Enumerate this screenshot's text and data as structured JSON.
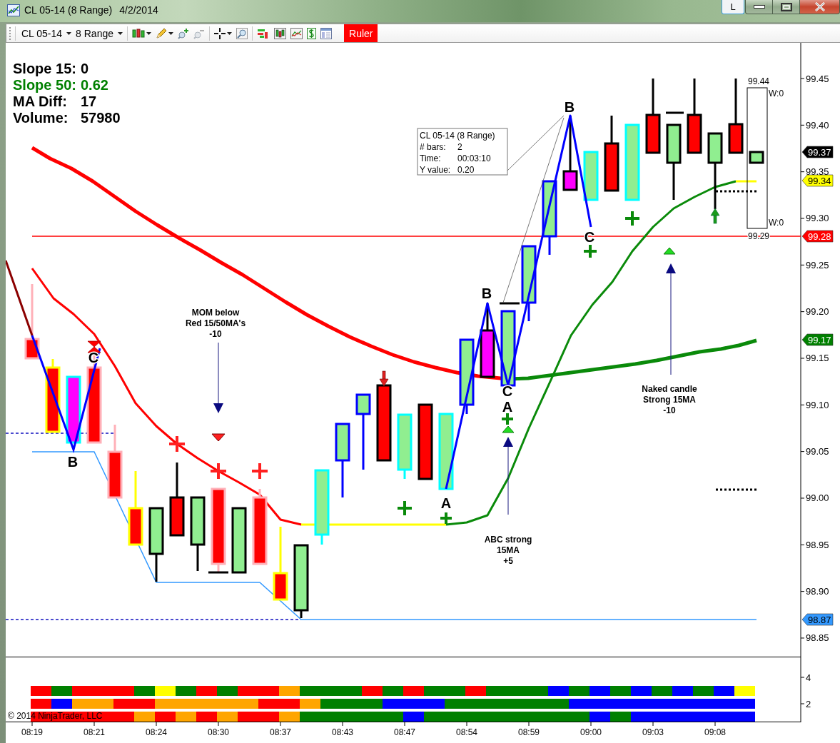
{
  "window": {
    "title": "CL 05-14 (8 Range)",
    "date": "4/2/2014",
    "layout_button": "L"
  },
  "toolbar": {
    "instrument": "CL 05-14",
    "interval": "8 Range",
    "ruler": {
      "label": "Ruler",
      "on": true
    }
  },
  "chart": {
    "stats": [
      {
        "label": "Slope 15:",
        "value": "0",
        "color": "#000000"
      },
      {
        "label": "Slope 50:",
        "value": "0.62",
        "color": "#008000"
      },
      {
        "label": "MA Diff:",
        "value": "17",
        "color": "#000000"
      },
      {
        "label": "Volume:",
        "value": "57980",
        "color": "#000000"
      }
    ],
    "ruler_box": {
      "title": "CL 05-14 (8 Range)",
      "rows": [
        {
          "label": "# bars:",
          "value": "2"
        },
        {
          "label": "Time:",
          "value": "00:03:10"
        },
        {
          "label": "Y value:",
          "value": "0.20"
        }
      ]
    },
    "annotations": [
      {
        "lines": [
          "MOM below",
          "Red 15/50MA's",
          "-10"
        ]
      },
      {
        "lines": [
          "ABC strong",
          "15MA",
          "+5"
        ]
      },
      {
        "lines": [
          "Naked candle",
          "Strong 15MA",
          "-10"
        ]
      }
    ],
    "wave_labels": [
      {
        "text": "C"
      },
      {
        "text": "B"
      },
      {
        "text": "A"
      },
      {
        "text": "B"
      },
      {
        "text": "C"
      },
      {
        "text": "A"
      },
      {
        "text": "B"
      },
      {
        "text": "C"
      }
    ],
    "range_box": {
      "high": "99.44",
      "low": "99.29",
      "top_label": "W:0",
      "bottom_label": "W:0"
    },
    "price_ticks": [
      "99.45",
      "99.40",
      "99.35",
      "99.30",
      "99.25",
      "99.20",
      "99.15",
      "99.10",
      "99.05",
      "99.00",
      "98.95",
      "98.90",
      "98.85"
    ],
    "price_tags": [
      {
        "text": "99.37",
        "color": "#000000"
      },
      {
        "text": "99.34",
        "color": "#ffff00"
      },
      {
        "text": "99.28",
        "color": "#ff0000"
      },
      {
        "text": "99.17",
        "color": "#008000"
      },
      {
        "text": "98.87",
        "color": "#3399ff"
      }
    ]
  },
  "indicator_panel": {
    "ticks": [
      "4",
      "2"
    ],
    "copyright": "© 2014 NinjaTrader, LLC",
    "rows": [
      {
        "cells": [
          {
            "color": "#ff0000"
          },
          {
            "color": "#008000"
          },
          {
            "color": "#ff0000"
          },
          {
            "color": "#ff0000"
          },
          {
            "color": "#ff0000"
          },
          {
            "color": "#008000"
          },
          {
            "color": "#ffff00"
          },
          {
            "color": "#008000"
          },
          {
            "color": "#ff0000"
          },
          {
            "color": "#008000"
          },
          {
            "color": "#ff0000"
          },
          {
            "color": "#ff0000"
          },
          {
            "color": "#ffa500"
          },
          {
            "color": "#008000"
          },
          {
            "color": "#008000"
          },
          {
            "color": "#008000"
          },
          {
            "color": "#ff0000"
          },
          {
            "color": "#008000"
          },
          {
            "color": "#ff0000"
          },
          {
            "color": "#008000"
          },
          {
            "color": "#008000"
          },
          {
            "color": "#ff0000"
          },
          {
            "color": "#008000"
          },
          {
            "color": "#008000"
          },
          {
            "color": "#008000"
          },
          {
            "color": "#0000ff"
          },
          {
            "color": "#008000"
          },
          {
            "color": "#0000ff"
          },
          {
            "color": "#008000"
          },
          {
            "color": "#0000ff"
          },
          {
            "color": "#008000"
          },
          {
            "color": "#0000ff"
          },
          {
            "color": "#008000"
          },
          {
            "color": "#0000ff"
          },
          {
            "color": "#ffff00"
          }
        ]
      },
      {
        "cells": [
          {
            "color": "#ff0000"
          },
          {
            "color": "#0000ff"
          },
          {
            "color": "#ffa500"
          },
          {
            "color": "#ffa500"
          },
          {
            "color": "#ff0000"
          },
          {
            "color": "#ff0000"
          },
          {
            "color": "#ffa500"
          },
          {
            "color": "#ffa500"
          },
          {
            "color": "#ffa500"
          },
          {
            "color": "#ffa500"
          },
          {
            "color": "#ffa500"
          },
          {
            "color": "#ff0000"
          },
          {
            "color": "#ff0000"
          },
          {
            "color": "#ffa500"
          },
          {
            "color": "#008000"
          },
          {
            "color": "#008000"
          },
          {
            "color": "#008000"
          },
          {
            "color": "#0000ff"
          },
          {
            "color": "#0000ff"
          },
          {
            "color": "#0000ff"
          },
          {
            "color": "#008000"
          },
          {
            "color": "#008000"
          },
          {
            "color": "#008000"
          },
          {
            "color": "#008000"
          },
          {
            "color": "#008000"
          },
          {
            "color": "#008000"
          },
          {
            "color": "#0000ff"
          },
          {
            "color": "#0000ff"
          },
          {
            "color": "#0000ff"
          },
          {
            "color": "#0000ff"
          },
          {
            "color": "#0000ff"
          },
          {
            "color": "#0000ff"
          },
          {
            "color": "#0000ff"
          },
          {
            "color": "#0000ff"
          },
          {
            "color": "#0000ff"
          }
        ]
      },
      {
        "cells": [
          {
            "color": "#ff0000"
          },
          {
            "color": "#ff0000"
          },
          {
            "color": "#ff0000"
          },
          {
            "color": "#ff0000"
          },
          {
            "color": "#ff0000"
          },
          {
            "color": "#ffa500"
          },
          {
            "color": "#ff0000"
          },
          {
            "color": "#ffa500"
          },
          {
            "color": "#ff0000"
          },
          {
            "color": "#ffa500"
          },
          {
            "color": "#ff0000"
          },
          {
            "color": "#ff0000"
          },
          {
            "color": "#ffa500"
          },
          {
            "color": "#008000"
          },
          {
            "color": "#008000"
          },
          {
            "color": "#008000"
          },
          {
            "color": "#008000"
          },
          {
            "color": "#008000"
          },
          {
            "color": "#0000ff"
          },
          {
            "color": "#008000"
          },
          {
            "color": "#008000"
          },
          {
            "color": "#008000"
          },
          {
            "color": "#008000"
          },
          {
            "color": "#008000"
          },
          {
            "color": "#008000"
          },
          {
            "color": "#008000"
          },
          {
            "color": "#008000"
          },
          {
            "color": "#0000ff"
          },
          {
            "color": "#008000"
          },
          {
            "color": "#0000ff"
          },
          {
            "color": "#0000ff"
          },
          {
            "color": "#0000ff"
          },
          {
            "color": "#0000ff"
          },
          {
            "color": "#0000ff"
          },
          {
            "color": "#0000ff"
          }
        ]
      }
    ]
  },
  "time_axis": {
    "ticks": [
      "08:19",
      "08:21",
      "08:24",
      "08:30",
      "08:37",
      "08:43",
      "08:47",
      "08:54",
      "08:59",
      "09:00",
      "09:03",
      "09:08"
    ]
  }
}
